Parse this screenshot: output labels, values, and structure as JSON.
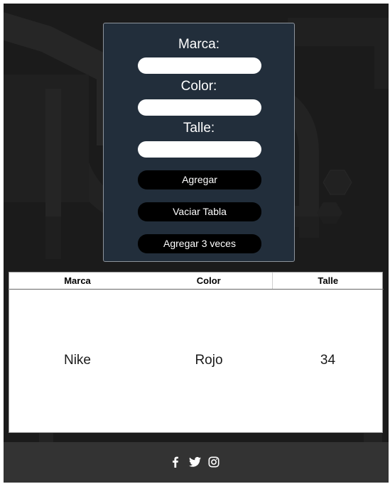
{
  "form": {
    "fields": [
      {
        "label": "Marca:",
        "value": "",
        "placeholder": ""
      },
      {
        "label": "Color:",
        "value": "",
        "placeholder": ""
      },
      {
        "label": "Talle:",
        "value": "",
        "placeholder": ""
      }
    ],
    "buttons": {
      "add": "Agregar",
      "clear": "Vaciar Tabla",
      "add_three": "Agregar 3 veces"
    }
  },
  "table": {
    "headers": [
      "Marca",
      "Color",
      "Talle"
    ],
    "rows": [
      [
        "Nike",
        "Rojo",
        "34"
      ]
    ]
  },
  "footer": {
    "social_icons": [
      "facebook-icon",
      "twitter-icon",
      "instagram-icon"
    ]
  },
  "colors": {
    "panel": "#222e3b",
    "background": "#1b1b1b",
    "footer": "#333333",
    "button": "#000000"
  }
}
